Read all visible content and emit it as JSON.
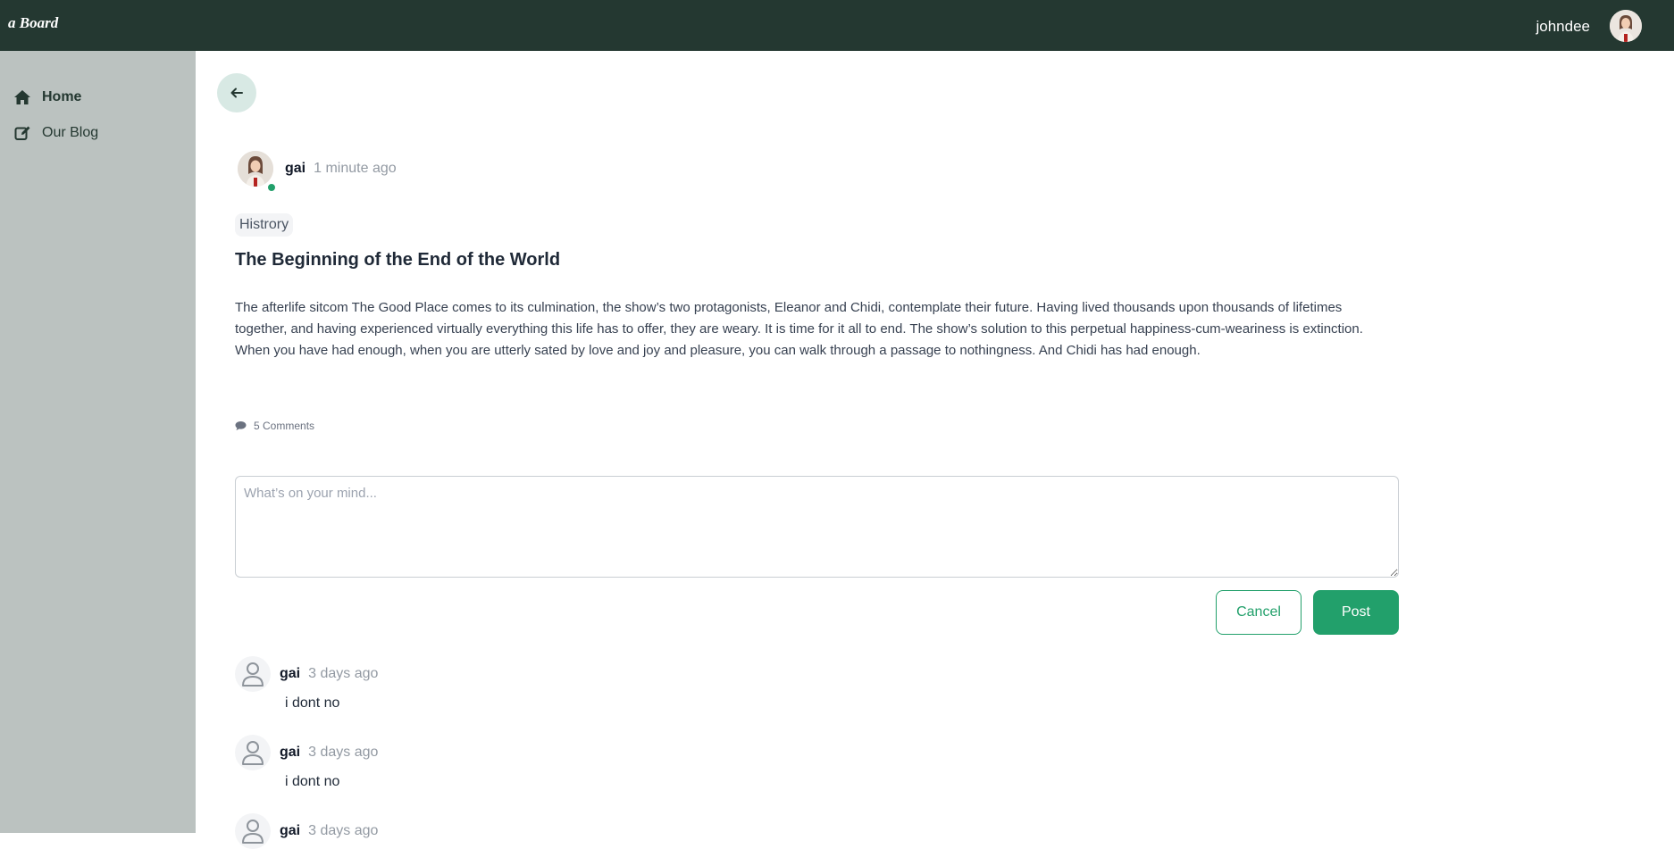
{
  "app": {
    "brand": "a Board"
  },
  "header": {
    "username": "johndee",
    "avatar_icon": "user-photo"
  },
  "sidebar": {
    "items": [
      {
        "label": "Home",
        "icon": "home-icon",
        "active": true
      },
      {
        "label": "Our Blog",
        "icon": "edit-icon",
        "active": false
      }
    ]
  },
  "post": {
    "author": "gai",
    "time": "1 minute ago",
    "online": true,
    "tag": "Histrory",
    "title": "The Beginning of the End of the World",
    "body": "The afterlife sitcom The Good Place comes to its culmination, the show’s two protagonists, Eleanor and Chidi, contemplate their future. Having lived thousands upon thousands of lifetimes together, and having experienced virtually everything this life has to offer, they are weary. It is time for it all to end. The show’s solution to this perpetual happiness-cum-weariness is extinction. When you have had enough, when you are utterly sated by love and joy and pleasure, you can walk through a passage to nothingness. And Chidi has had enough.",
    "comments_label": "5 Comments"
  },
  "composer": {
    "placeholder": "What’s on your mind...",
    "value": "",
    "cancel_label": "Cancel",
    "post_label": "Post"
  },
  "comments": [
    {
      "author": "gai",
      "time": "3 days ago",
      "text": "i dont no"
    },
    {
      "author": "gai",
      "time": "3 days ago",
      "text": "i dont no"
    },
    {
      "author": "gai",
      "time": "3 days ago",
      "text": ""
    }
  ],
  "colors": {
    "header_bg": "#243831",
    "sidebar_bg": "#bbc2c0",
    "accent": "#22a06b",
    "back_button_bg": "#d8e9e4"
  }
}
